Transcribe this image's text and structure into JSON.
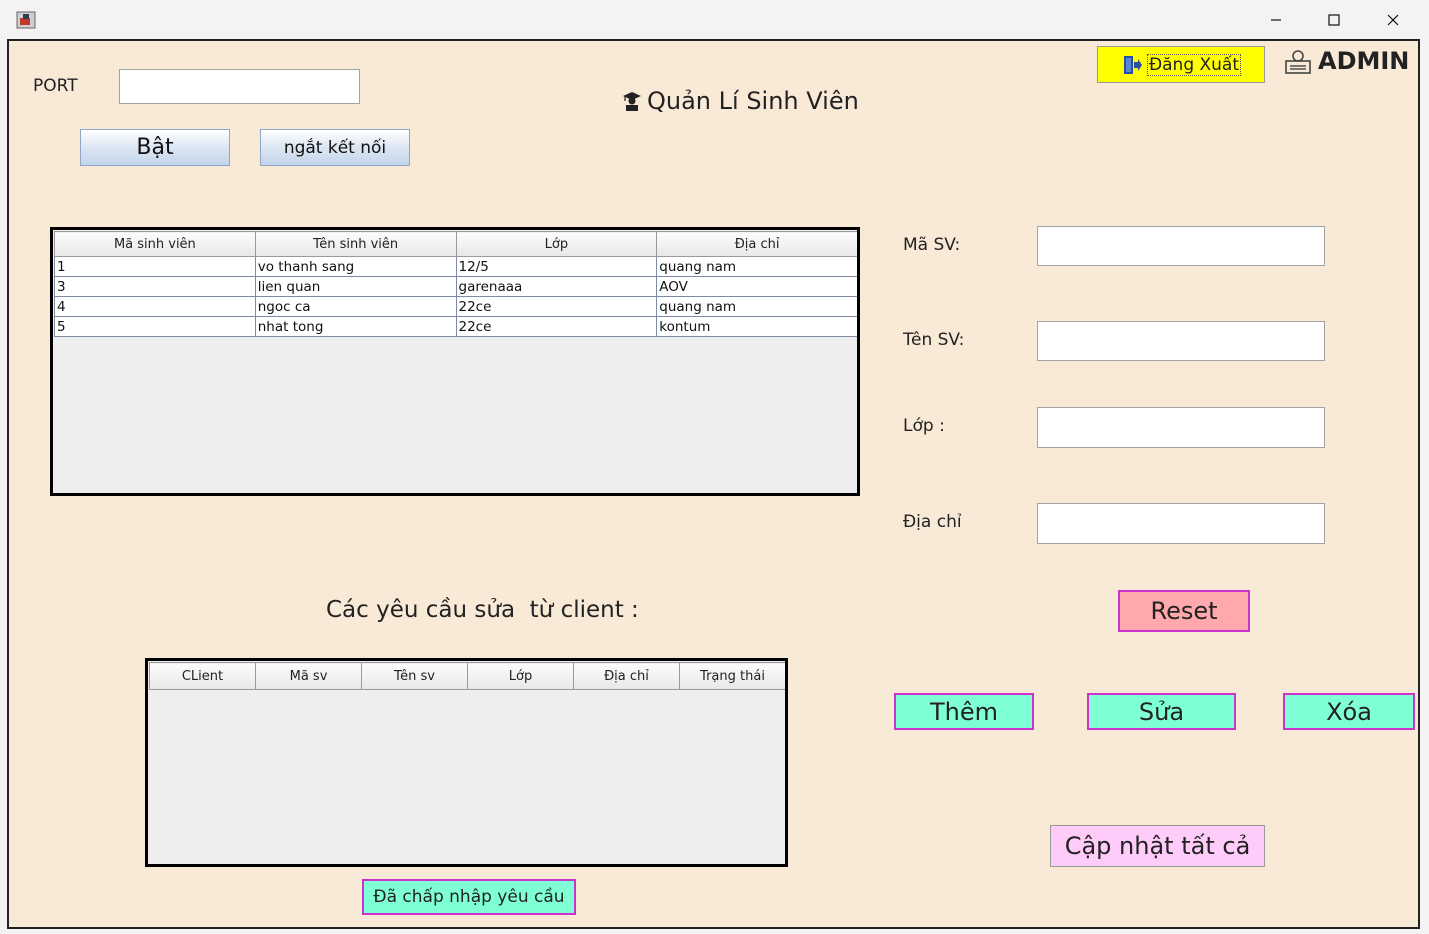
{
  "window": {
    "minimize_glyph": "—",
    "maximize_glyph": "☐",
    "close_glyph": "✕"
  },
  "server": {
    "port_label": "PORT",
    "port_value": "",
    "start_label": "Bật",
    "disconnect_label": "ngắt kết nối"
  },
  "header": {
    "title": "Quản Lí Sinh Viên",
    "logout_label": "Đăng Xuất",
    "user_label": "ADMIN"
  },
  "students_table": {
    "columns": [
      "Mã sinh viên",
      "Tên sinh viên",
      "Lớp",
      "Địa chỉ"
    ],
    "rows": [
      [
        "1",
        "vo thanh sang",
        "12/5",
        "quang nam"
      ],
      [
        "3",
        "lien quan",
        "garenaaa",
        "AOV"
      ],
      [
        "4",
        "ngoc ca",
        "22ce",
        "quang nam"
      ],
      [
        "5",
        "nhat tong",
        "22ce",
        "kontum"
      ]
    ]
  },
  "form": {
    "ma_label": "Mã SV:",
    "ten_label": "Tên SV:",
    "lop_label": "Lớp :",
    "diachi_label": "Địa chỉ",
    "ma_value": "",
    "ten_value": "",
    "lop_value": "",
    "diachi_value": "",
    "reset_label": "Reset",
    "add_label": "Thêm",
    "edit_label": "Sửa",
    "delete_label": "Xóa",
    "update_all_label": "Cập nhật tất cả"
  },
  "requests": {
    "title": "Các yêu cầu sửa  từ client :",
    "columns": [
      "CLient",
      "Mã sv",
      "Tên sv",
      "Lớp",
      "Địa chỉ",
      "Trạng thái"
    ],
    "accept_label": "Đã chấp nhập yêu cầu"
  },
  "colors": {
    "background": "#f9ead7",
    "logout": "#ffff00",
    "reset": "#ffa8ad",
    "action": "#7effd6",
    "update_all": "#ffccfa",
    "accept": "#7effd6"
  }
}
